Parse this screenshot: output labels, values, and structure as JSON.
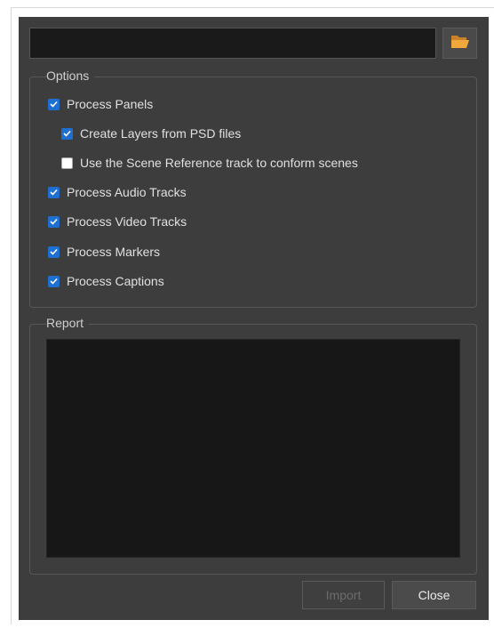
{
  "path_field": {
    "value": "",
    "placeholder": ""
  },
  "browse_icon": "folder-open-icon",
  "options": {
    "title": "Options",
    "items": [
      {
        "label": "Process Panels",
        "checked": true
      },
      {
        "label": "Create Layers from PSD files",
        "checked": true
      },
      {
        "label": "Use the Scene Reference track to conform scenes",
        "checked": false
      },
      {
        "label": "Process Audio Tracks",
        "checked": true
      },
      {
        "label": "Process Video Tracks",
        "checked": true
      },
      {
        "label": "Process Markers",
        "checked": true
      },
      {
        "label": "Process Captions",
        "checked": true
      }
    ]
  },
  "report": {
    "title": "Report",
    "content": ""
  },
  "buttons": {
    "import_label": "Import",
    "close_label": "Close"
  },
  "colors": {
    "dialog_bg": "#3d3d3d",
    "checkbox_checked": "#1f6fd1",
    "field_bg": "#1a1a1a",
    "folder_icon": "#f0a83c"
  }
}
